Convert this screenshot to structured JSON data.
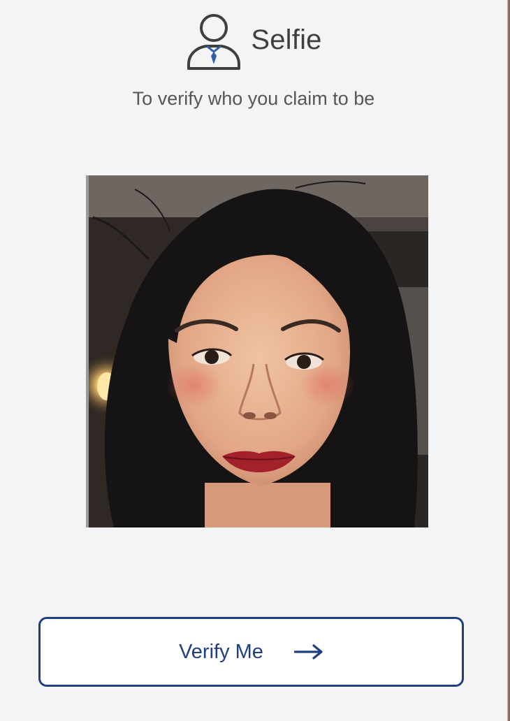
{
  "header": {
    "title": "Selfie",
    "icon": "user-with-tie-icon"
  },
  "subtitle": "To verify who you claim to be",
  "photo": {
    "icon": "selfie-photo"
  },
  "verify_button": {
    "label": "Verify Me",
    "icon": "arrow-right-icon"
  },
  "colors": {
    "background": "#f4f4f4",
    "accent": "#1f3f82",
    "icon_stroke": "#3f3f3f",
    "text": "#565656"
  }
}
